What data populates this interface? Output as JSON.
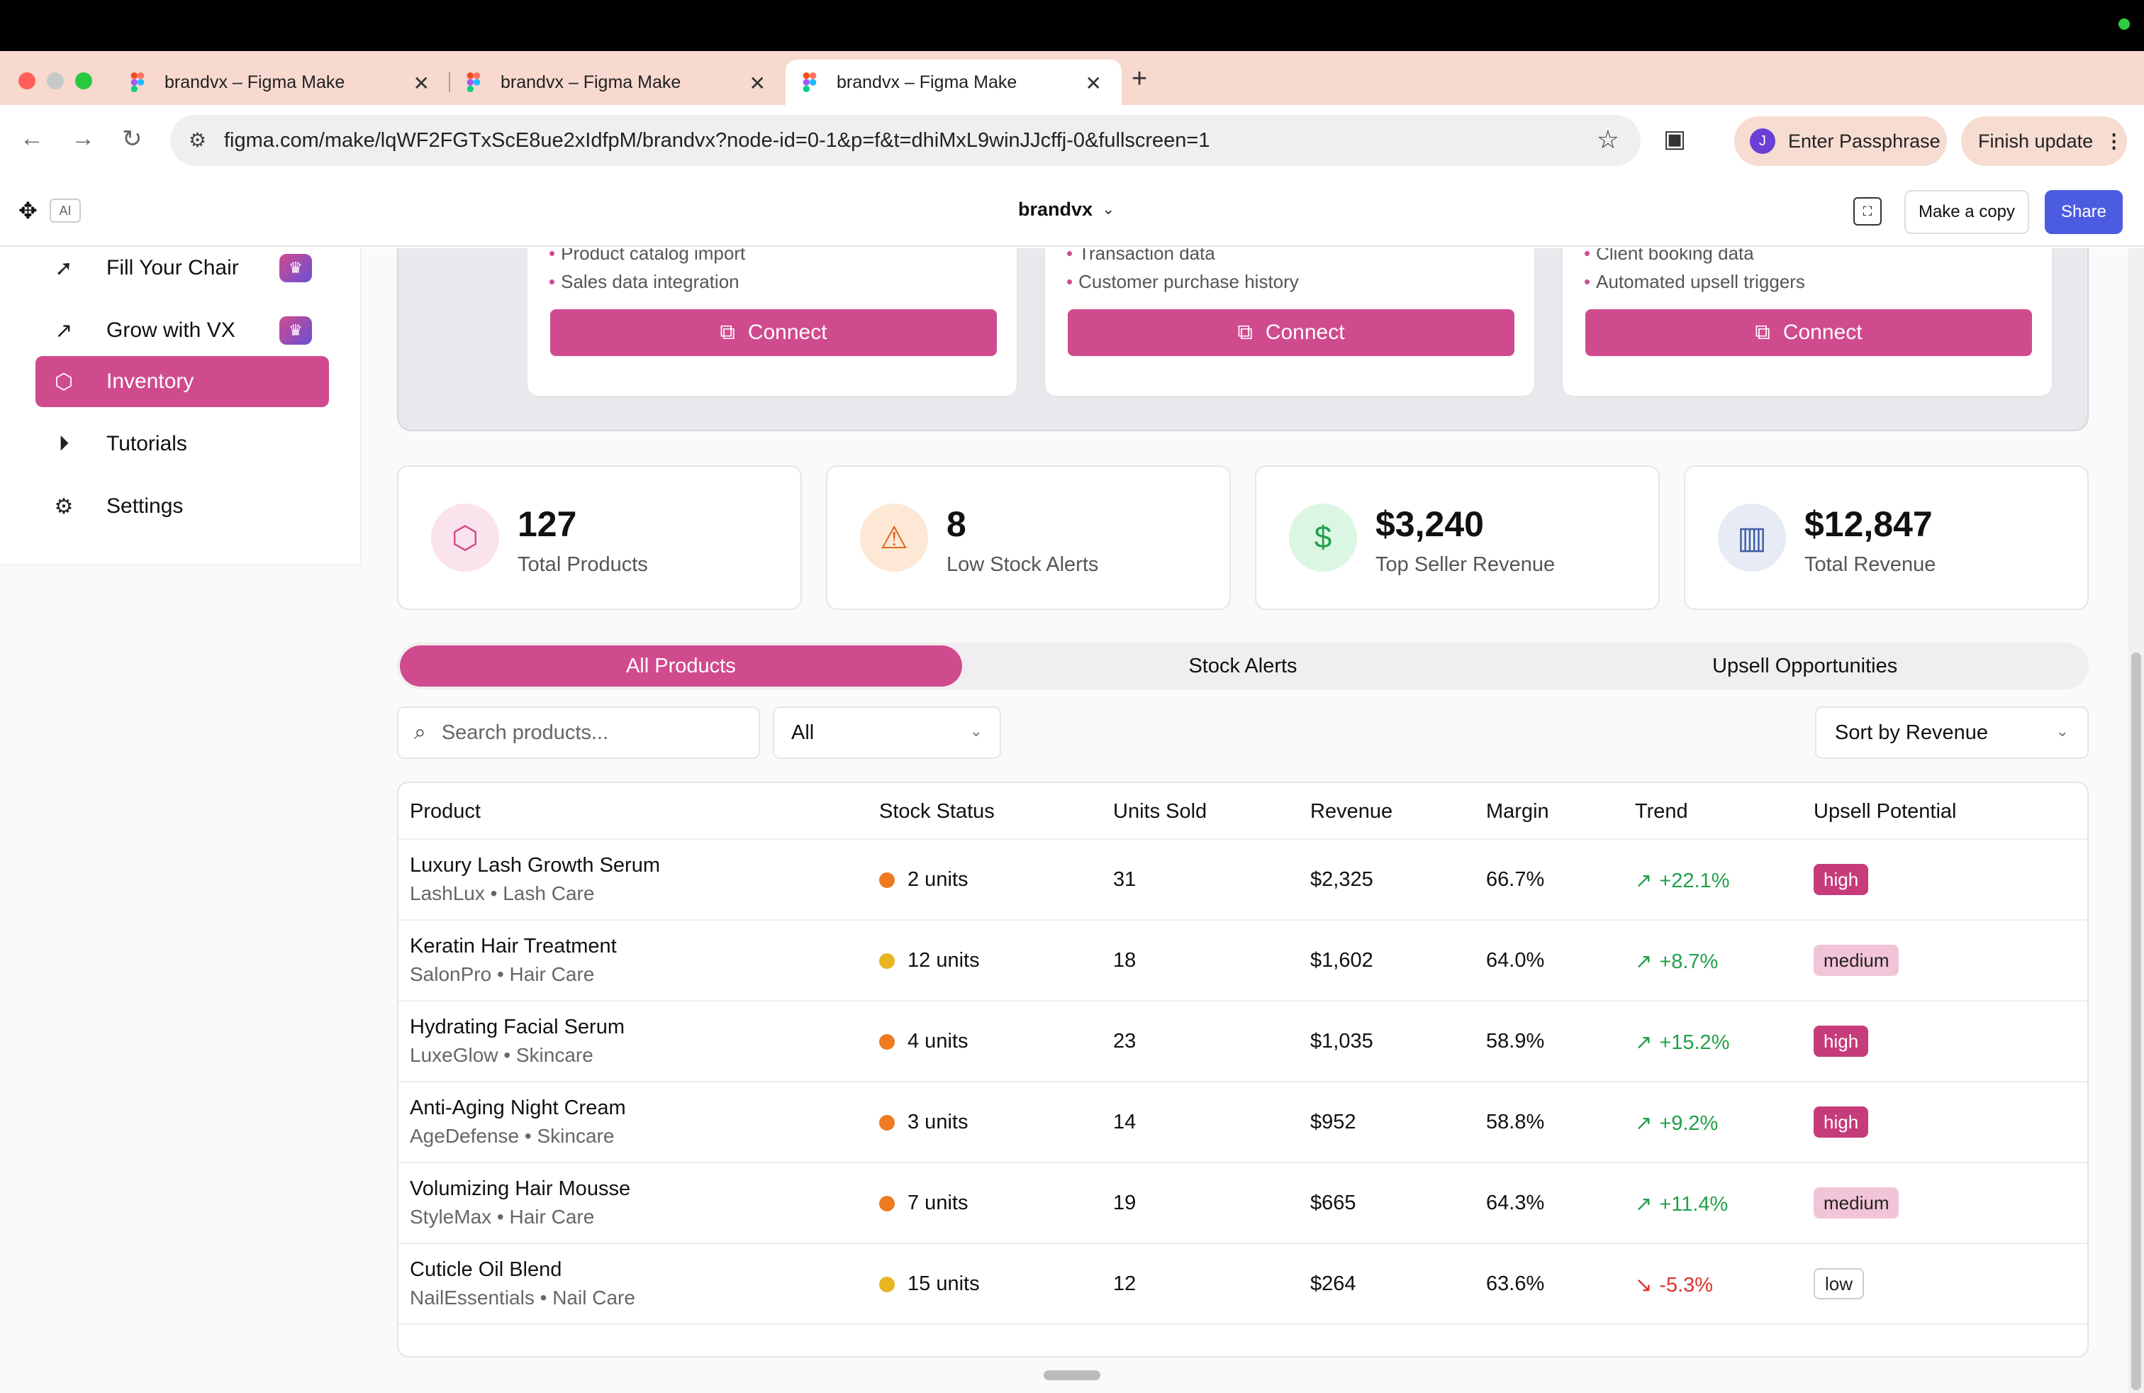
{
  "browser": {
    "tabs": [
      {
        "title": "brandvx – Figma Make"
      },
      {
        "title": "brandvx – Figma Make"
      },
      {
        "title": "brandvx – Figma Make"
      }
    ],
    "url": "figma.com/make/lqWF2FGTxScE8ue2xIdfpM/brandvx?node-id=0-1&p=f&t=dhiMxL9winJJcffj-0&fullscreen=1",
    "profile_initial": "J",
    "passphrase_label": "Enter Passphrase",
    "update_label": "Finish update"
  },
  "figma": {
    "ai_badge": "AI",
    "project_title": "brandvx",
    "copy_label": "Make a copy",
    "share_label": "Share"
  },
  "sidebar": {
    "items": [
      {
        "label": "Fill Your Chair",
        "icon": "cursor-icon",
        "premium": true
      },
      {
        "label": "Grow with VX",
        "icon": "trending-up-icon",
        "premium": true
      },
      {
        "label": "Inventory",
        "icon": "box-icon",
        "active": true
      },
      {
        "label": "Tutorials",
        "icon": "play-circle-icon"
      },
      {
        "label": "Settings",
        "icon": "gear-icon"
      }
    ]
  },
  "integrations": [
    {
      "bullets": [
        "Product catalog import",
        "Sales data integration"
      ],
      "button": "Connect"
    },
    {
      "bullets": [
        "Transaction data",
        "Customer purchase history"
      ],
      "button": "Connect"
    },
    {
      "bullets": [
        "Client booking data",
        "Automated upsell triggers"
      ],
      "button": "Connect"
    }
  ],
  "stats": [
    {
      "value": "127",
      "label": "Total Products",
      "icon": "box-icon"
    },
    {
      "value": "8",
      "label": "Low Stock Alerts",
      "icon": "warning-icon"
    },
    {
      "value": "$3,240",
      "label": "Top Seller Revenue",
      "icon": "dollar-icon"
    },
    {
      "value": "$12,847",
      "label": "Total Revenue",
      "icon": "bar-chart-icon"
    }
  ],
  "tabs": [
    {
      "label": "All Products",
      "active": true
    },
    {
      "label": "Stock Alerts"
    },
    {
      "label": "Upsell Opportunities"
    }
  ],
  "filters": {
    "search_placeholder": "Search products...",
    "category": "All",
    "sort": "Sort by Revenue"
  },
  "table": {
    "headers": [
      "Product",
      "Stock Status",
      "Units Sold",
      "Revenue",
      "Margin",
      "Trend",
      "Upsell Potential"
    ],
    "rows": [
      {
        "name": "Luxury Lash Growth Serum",
        "sub": "LashLux • Lash Care",
        "stock": "2 units",
        "stock_level": "low",
        "units": "31",
        "revenue": "$2,325",
        "margin": "66.7%",
        "trend": "+22.1%",
        "trend_dir": "up",
        "upsell": "high"
      },
      {
        "name": "Keratin Hair Treatment",
        "sub": "SalonPro • Hair Care",
        "stock": "12 units",
        "stock_level": "ok",
        "units": "18",
        "revenue": "$1,602",
        "margin": "64.0%",
        "trend": "+8.7%",
        "trend_dir": "up",
        "upsell": "medium"
      },
      {
        "name": "Hydrating Facial Serum",
        "sub": "LuxeGlow • Skincare",
        "stock": "4 units",
        "stock_level": "low",
        "units": "23",
        "revenue": "$1,035",
        "margin": "58.9%",
        "trend": "+15.2%",
        "trend_dir": "up",
        "upsell": "high"
      },
      {
        "name": "Anti-Aging Night Cream",
        "sub": "AgeDefense • Skincare",
        "stock": "3 units",
        "stock_level": "low",
        "units": "14",
        "revenue": "$952",
        "margin": "58.8%",
        "trend": "+9.2%",
        "trend_dir": "up",
        "upsell": "high"
      },
      {
        "name": "Volumizing Hair Mousse",
        "sub": "StyleMax • Hair Care",
        "stock": "7 units",
        "stock_level": "low",
        "units": "19",
        "revenue": "$665",
        "margin": "64.3%",
        "trend": "+11.4%",
        "trend_dir": "up",
        "upsell": "medium"
      },
      {
        "name": "Cuticle Oil Blend",
        "sub": "NailEssentials • Nail Care",
        "stock": "15 units",
        "stock_level": "ok",
        "units": "12",
        "revenue": "$264",
        "margin": "63.6%",
        "trend": "-5.3%",
        "trend_dir": "down",
        "upsell": "low"
      }
    ]
  },
  "colors": {
    "accent": "#d04b8d",
    "stock_low": "#ee7a22",
    "stock_ok": "#e8b520",
    "trend_up": "#22a04b",
    "trend_down": "#e0322f",
    "share": "#4c5ce0"
  }
}
